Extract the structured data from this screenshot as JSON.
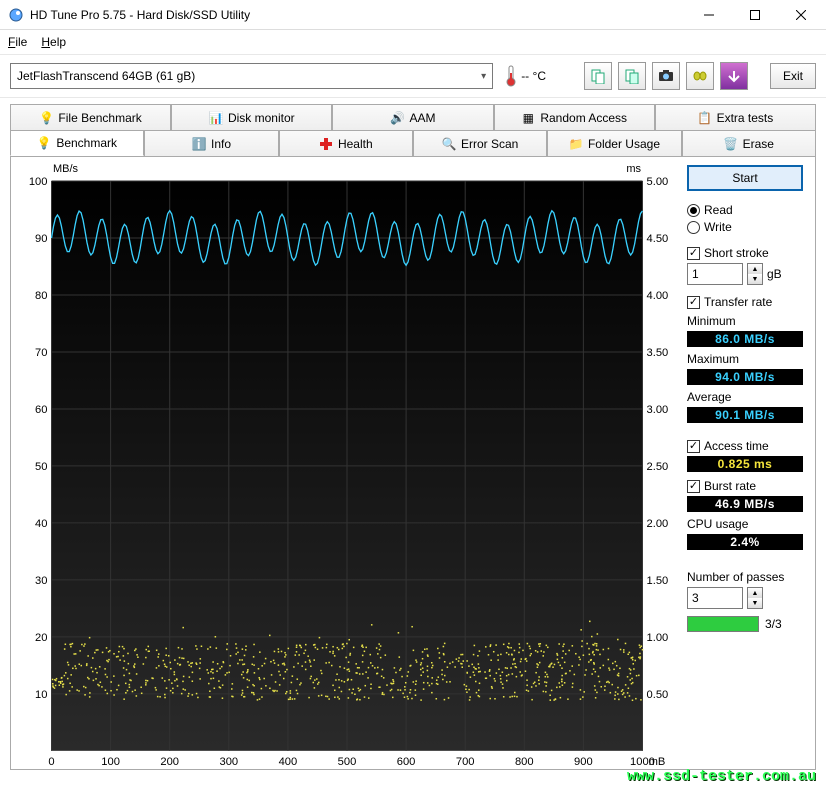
{
  "window": {
    "title": "HD Tune Pro 5.75 - Hard Disk/SSD Utility"
  },
  "menu": {
    "file": "File",
    "help": "Help"
  },
  "toolbar": {
    "drive": "JetFlashTranscend 64GB (61 gB)",
    "temp": "-- °C",
    "exit": "Exit"
  },
  "tabs_top": {
    "file_benchmark": "File Benchmark",
    "disk_monitor": "Disk monitor",
    "aam": "AAM",
    "random_access": "Random Access",
    "extra_tests": "Extra tests"
  },
  "tabs_bottom": {
    "benchmark": "Benchmark",
    "info": "Info",
    "health": "Health",
    "error_scan": "Error Scan",
    "folder_usage": "Folder Usage",
    "erase": "Erase"
  },
  "panel": {
    "start": "Start",
    "read": "Read",
    "write": "Write",
    "short_stroke": "Short stroke",
    "short_stroke_val": "1",
    "short_stroke_unit": "gB",
    "transfer_rate": "Transfer rate",
    "minimum": "Minimum",
    "min_val": "86.0 MB/s",
    "maximum": "Maximum",
    "max_val": "94.0 MB/s",
    "average": "Average",
    "avg_val": "90.1 MB/s",
    "access_time": "Access time",
    "access_val": "0.825 ms",
    "burst_rate": "Burst rate",
    "burst_val": "46.9 MB/s",
    "cpu_usage": "CPU usage",
    "cpu_val": "2.4%",
    "passes": "Number of passes",
    "passes_val": "3",
    "progress": "3/3"
  },
  "chart_data": {
    "type": "line",
    "xlabel": "mB",
    "x_range": [
      0,
      1000
    ],
    "x_ticks": [
      0,
      100,
      200,
      300,
      400,
      500,
      600,
      700,
      800,
      900,
      1000
    ],
    "left_axis": {
      "label": "MB/s",
      "range": [
        0,
        100
      ],
      "ticks": [
        10,
        20,
        30,
        40,
        50,
        60,
        70,
        80,
        90,
        100
      ]
    },
    "right_axis": {
      "label": "ms",
      "range": [
        0,
        5.0
      ],
      "ticks": [
        0.5,
        1.0,
        1.5,
        2.0,
        2.5,
        3.0,
        3.5,
        4.0,
        4.5,
        5.0
      ]
    },
    "series": [
      {
        "name": "Transfer rate (MB/s)",
        "axis": "left",
        "color": "#3ad1ff",
        "approx": "oscillates between 86 and 94 around mean 90 across full x range"
      },
      {
        "name": "Access time (ms)",
        "axis": "right",
        "color": "#f5e53c",
        "approx": "scatter mostly between 0.55 and 0.95, mean 0.825, across full x range"
      }
    ]
  },
  "watermark": "www.ssd-tester.com.au"
}
